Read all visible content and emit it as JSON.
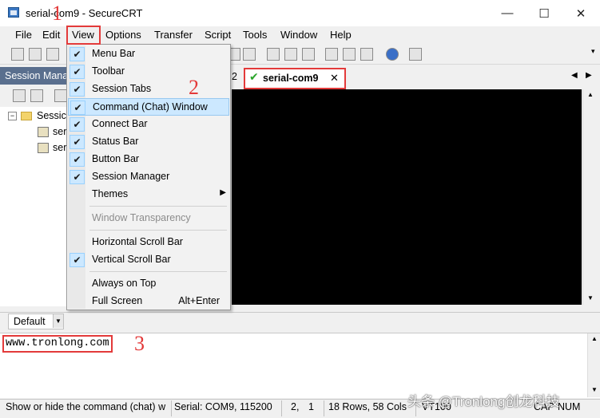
{
  "window": {
    "title": "serial-com9 - SecureCRT",
    "minimize_glyph": "—",
    "maximize_glyph": "☐",
    "close_glyph": "✕"
  },
  "menubar": [
    "File",
    "Edit",
    "View",
    "Options",
    "Transfer",
    "Script",
    "Tools",
    "Window",
    "Help"
  ],
  "session_manager": {
    "header": "Session Mana",
    "root": "Sessic",
    "items": [
      "ser",
      "ser"
    ]
  },
  "tab": {
    "label": "serial-com9",
    "prefix": "2"
  },
  "view_menu": {
    "items": [
      {
        "label": "Menu Bar",
        "checked": true
      },
      {
        "label": "Toolbar",
        "checked": true
      },
      {
        "label": "Session Tabs",
        "checked": true
      },
      {
        "label": "Command (Chat) Window",
        "checked": true,
        "highlighted": true
      },
      {
        "label": "Connect Bar",
        "checked": true
      },
      {
        "label": "Status Bar",
        "checked": true
      },
      {
        "label": "Button Bar",
        "checked": true
      },
      {
        "label": "Session Manager",
        "checked": true
      },
      {
        "label": "Themes",
        "submenu": true
      },
      {
        "label": "Window Transparency",
        "disabled": true
      },
      {
        "label": "Horizontal Scroll Bar"
      },
      {
        "label": "Vertical Scroll Bar",
        "checked": true
      },
      {
        "label": "Always on Top"
      },
      {
        "label": "Full Screen",
        "shortcut": "Alt+Enter"
      }
    ]
  },
  "chat": {
    "select_value": "Default",
    "text": "www.tronlong.com"
  },
  "statusbar": {
    "hint": "Show or hide the command (chat) w",
    "serial": "Serial: COM9, 115200",
    "position": "2,",
    "col": "1",
    "size": "18 Rows, 58 Cols",
    "emulation": "VT100",
    "cap": "CAP",
    "num": "NUM"
  },
  "annotations": [
    "1",
    "2",
    "3"
  ],
  "watermark": "头条 @Tronlong创龙科技",
  "colors": {
    "highlight_red": "#e33a3a",
    "session_header": "#5a6f8e",
    "menu_highlight": "#cce8ff",
    "terminal_bg": "#000000"
  }
}
